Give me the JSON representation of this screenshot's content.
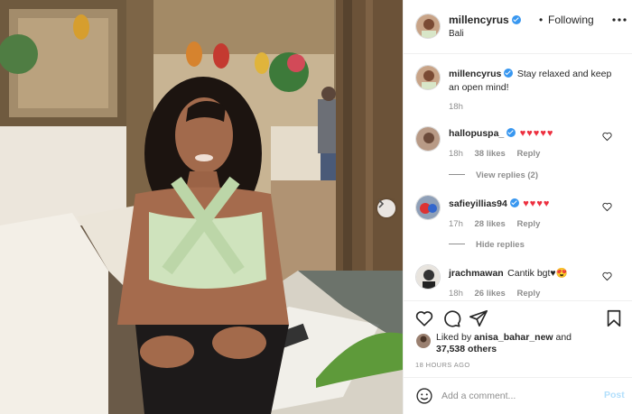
{
  "header": {
    "username": "millencyrus",
    "separator": "•",
    "follow_label": "Following",
    "location": "Bali"
  },
  "caption": {
    "username": "millencyrus",
    "text": "Stay relaxed and keep an open mind!",
    "age": "18h"
  },
  "comments": [
    {
      "username": "hallopuspa_",
      "verified": true,
      "text": "♥♥♥♥♥",
      "age": "18h",
      "likes": "38 likes",
      "reply": "Reply",
      "replies_label": "View replies (2)"
    },
    {
      "username": "safieyillias94",
      "verified": true,
      "text": "♥♥♥♥",
      "age": "17h",
      "likes": "28 likes",
      "reply": "Reply",
      "replies_label": "Hide replies"
    },
    {
      "username": "jrachmawan",
      "verified": false,
      "text": "Cantik bgt♥😍",
      "age": "18h",
      "likes": "26 likes",
      "reply": "Reply"
    }
  ],
  "likes": {
    "prefix": "Liked by",
    "first_user": "anisa_bahar_new",
    "conjunction": "and",
    "others": "37,538 others"
  },
  "timestamp": "18 HOURS AGO",
  "add_comment": {
    "placeholder": "Add a comment...",
    "post_label": "Post"
  },
  "colors": {
    "verified": "#3897f0",
    "heart": "#ed2f3f",
    "post_disabled": "#b2dffc",
    "meta_text": "#8e8e8e"
  },
  "icons": [
    "more-options-icon",
    "heart-icon",
    "comment-icon",
    "share-icon",
    "bookmark-icon",
    "smiley-icon",
    "chevron-right-icon",
    "verified-badge-icon"
  ]
}
